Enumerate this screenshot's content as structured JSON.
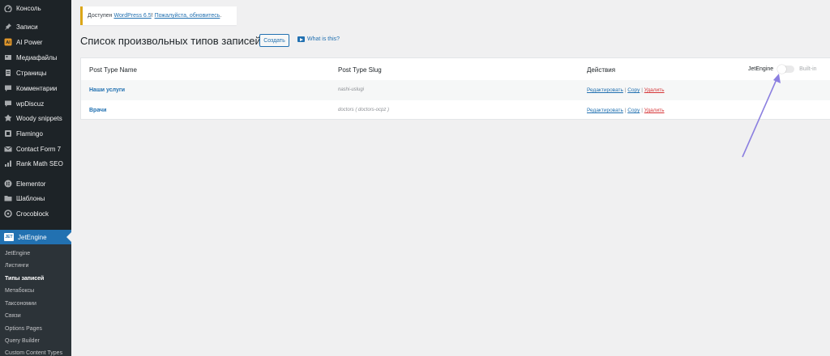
{
  "sidebar": {
    "items": [
      {
        "label": "Консоль",
        "icon": "dashboard-icon"
      },
      {
        "label": "Записи",
        "icon": "pin-icon"
      },
      {
        "label": "AI Power",
        "icon": "ai-icon"
      },
      {
        "label": "Медиафайлы",
        "icon": "media-icon"
      },
      {
        "label": "Страницы",
        "icon": "page-icon"
      },
      {
        "label": "Комментарии",
        "icon": "comment-icon"
      },
      {
        "label": "wpDiscuz",
        "icon": "comment-icon"
      },
      {
        "label": "Woody snippets",
        "icon": "snippet-icon"
      },
      {
        "label": "Flamingo",
        "icon": "flamingo-icon"
      },
      {
        "label": "Contact Form 7",
        "icon": "mail-icon"
      },
      {
        "label": "Rank Math SEO",
        "icon": "chart-icon"
      },
      {
        "label": "Elementor",
        "icon": "elementor-icon"
      },
      {
        "label": "Шаблоны",
        "icon": "folder-icon"
      },
      {
        "label": "Crocoblock",
        "icon": "crocoblock-icon"
      }
    ],
    "active": {
      "label": "JetEngine",
      "icon": "jetengine-icon"
    },
    "submenu": [
      {
        "label": "JetEngine"
      },
      {
        "label": "Листинги"
      },
      {
        "label": "Типы записей"
      },
      {
        "label": "Метабоксы"
      },
      {
        "label": "Таксономии"
      },
      {
        "label": "Связи"
      },
      {
        "label": "Options Pages"
      },
      {
        "label": "Query Builder"
      },
      {
        "label": "Custom Content Types"
      }
    ]
  },
  "notice": {
    "prefix": "Доступен",
    "link1": "WordPress 6.5",
    "separator": "!",
    "link2": "Пожалуйста, обновитесь",
    "suffix": "."
  },
  "page": {
    "title": "Список произвольных типов записей",
    "add_button": "Создать",
    "help_link": "What is this?"
  },
  "table": {
    "headers": [
      "Post Type Name",
      "Post Type Slug",
      "Действия"
    ],
    "toggle": {
      "left_label": "JetEngine",
      "right_label": "Built-in",
      "state": "off"
    },
    "rows": [
      {
        "name": "Наши услуги",
        "slug": "nashi-uslugi",
        "actions": [
          "Редактировать",
          "Copy",
          "Удалить"
        ]
      },
      {
        "name": "Врачи",
        "slug": "doctors ( doctors-ocpz )",
        "actions": [
          "Редактировать",
          "Copy",
          "Удалить"
        ]
      }
    ],
    "action_separator": " | "
  },
  "colors": {
    "sidebar_bg": "#1d2327",
    "accent": "#2271b1",
    "delete": "#d63638",
    "notice_border": "#dba617",
    "annotation_arrow": "#8b7fe0"
  }
}
